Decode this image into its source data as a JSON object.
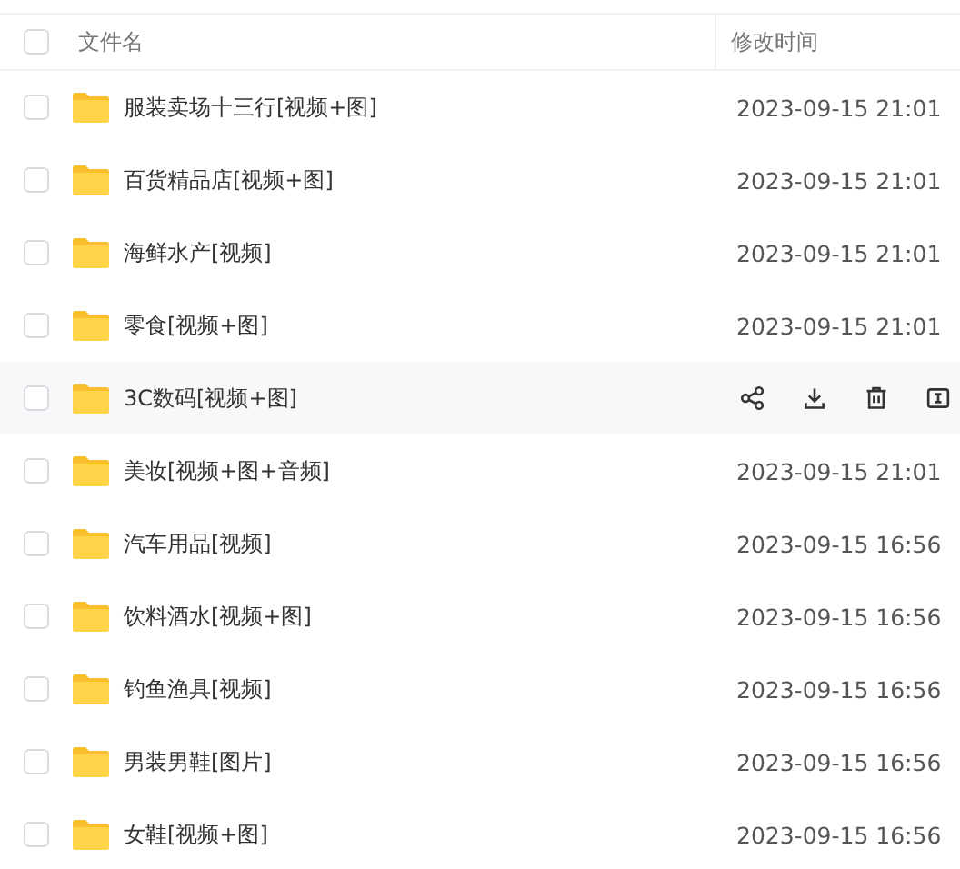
{
  "header": {
    "checked": false,
    "columns": [
      "文件名",
      "修改时间"
    ]
  },
  "rows": [
    {
      "name": "服装卖场十三行[视频+图]",
      "time": "2023-09-15 21:01",
      "checked": false,
      "hovered": false
    },
    {
      "name": "百货精品店[视频+图]",
      "time": "2023-09-15 21:01",
      "checked": false,
      "hovered": false
    },
    {
      "name": "海鲜水产[视频]",
      "time": "2023-09-15 21:01",
      "checked": false,
      "hovered": false
    },
    {
      "name": "零食[视频+图]",
      "time": "2023-09-15 21:01",
      "checked": false,
      "hovered": false
    },
    {
      "name": "3C数码[视频+图]",
      "checked": false,
      "hovered": true
    },
    {
      "name": "美妆[视频+图+音频]",
      "time": "2023-09-15 21:01",
      "checked": false,
      "hovered": false
    },
    {
      "name": "汽车用品[视频]",
      "time": "2023-09-15 16:56",
      "checked": false,
      "hovered": false
    },
    {
      "name": "饮料酒水[视频+图]",
      "time": "2023-09-15 16:56",
      "checked": false,
      "hovered": false
    },
    {
      "name": "钓鱼渔具[视频]",
      "time": "2023-09-15 16:56",
      "checked": false,
      "hovered": false
    },
    {
      "name": "男装男鞋[图片]",
      "time": "2023-09-15 16:56",
      "checked": false,
      "hovered": false
    },
    {
      "name": "女鞋[视频+图]",
      "time": "2023-09-15 16:56",
      "checked": false,
      "hovered": false
    }
  ]
}
